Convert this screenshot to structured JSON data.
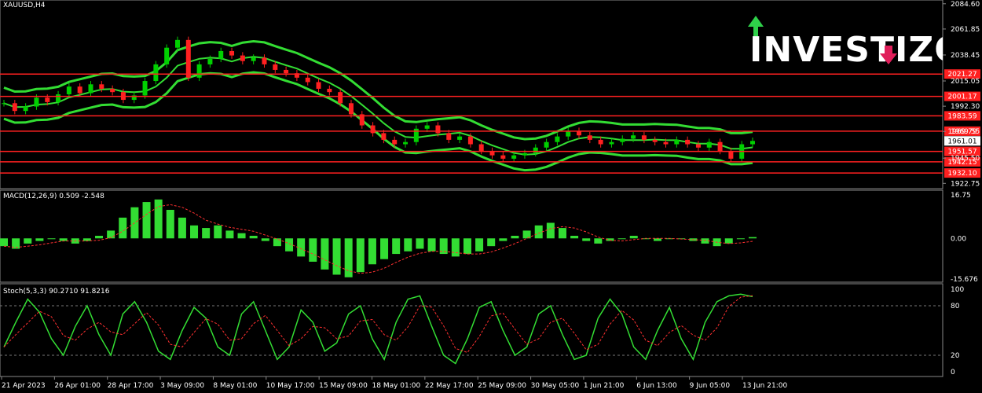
{
  "symbol": "XAUUSD,H4",
  "chart_data": [
    {
      "type": "line",
      "title": "XAUUSD,H4",
      "price_axis_ticks": [
        "2084.60",
        "2061.85",
        "2038.45",
        "2015.05",
        "1992.30",
        "1969.55",
        "1945.50",
        "1922.75"
      ],
      "price_axis_values": [
        2084.6,
        2061.85,
        2038.45,
        2015.05,
        1992.3,
        1969.55,
        1945.5,
        1922.75
      ],
      "ylim": [
        1918,
        2088
      ],
      "current_price": "1961.01",
      "horizontal_levels": [
        {
          "label": "2021.27",
          "value": 2021.27
        },
        {
          "label": "2001.17",
          "value": 2001.17
        },
        {
          "label": "1983.59",
          "value": 1983.59
        },
        {
          "label": "1969.79",
          "value": 1969.79
        },
        {
          "label": "1951.57",
          "value": 1951.57
        },
        {
          "label": "1942.15",
          "value": 1942.15
        },
        {
          "label": "1932.10",
          "value": 1932.1
        }
      ],
      "time_labels": [
        "21 Apr 2023",
        "26 Apr 01:00",
        "28 Apr 17:00",
        "3 May 09:00",
        "8 May 01:00",
        "10 May 17:00",
        "15 May 09:00",
        "18 May 01:00",
        "22 May 17:00",
        "25 May 09:00",
        "30 May 05:00",
        "1 Jun 21:00",
        "6 Jun 13:00",
        "9 Jun 05:00",
        "13 Jun 21:00"
      ],
      "price_path": [
        1995,
        1988,
        1992,
        2000,
        1996,
        2003,
        2010,
        2004,
        2012,
        2008,
        2005,
        1998,
        2002,
        2015,
        2030,
        2045,
        2052,
        2018,
        2030,
        2035,
        2042,
        2038,
        2033,
        2036,
        2030,
        2025,
        2022,
        2018,
        2014,
        2008,
        2005,
        1995,
        1985,
        1975,
        1968,
        1962,
        1958,
        1960,
        1972,
        1975,
        1968,
        1962,
        1965,
        1958,
        1952,
        1948,
        1945,
        1948,
        1950,
        1955,
        1960,
        1965,
        1970,
        1966,
        1962,
        1958,
        1960,
        1963,
        1966,
        1962,
        1960,
        1958,
        1962,
        1958,
        1955,
        1960,
        1952,
        1945,
        1958,
        1961
      ],
      "series": [
        {
          "name": "MACD(12,26,9) 0.509 -2.548",
          "values": [
            -3,
            -4,
            -2,
            -1,
            0,
            -1,
            -2,
            -1,
            1,
            3,
            8,
            12,
            14,
            15,
            11,
            8,
            5,
            4,
            5,
            3,
            2,
            1,
            -1,
            -3,
            -5,
            -7,
            -9,
            -12,
            -14,
            -15,
            -13,
            -10,
            -8,
            -6,
            -5,
            -4,
            -5,
            -6,
            -7,
            -6,
            -5,
            -3,
            -1,
            1,
            3,
            5,
            6,
            4,
            1,
            -1,
            -2,
            -1,
            0,
            1,
            0,
            -1,
            0,
            0,
            -1,
            -2,
            -3,
            -2,
            0,
            0.5
          ],
          "ylim": [
            -15.676,
            16.75
          ],
          "ticks": [
            "16.75",
            "0.00",
            "-15.676"
          ]
        },
        {
          "name": "Stoch(5,3,3) 90.2710 91.8216",
          "values": [
            30,
            60,
            88,
            72,
            40,
            20,
            55,
            80,
            45,
            20,
            70,
            85,
            60,
            25,
            15,
            50,
            78,
            65,
            30,
            20,
            70,
            85,
            50,
            15,
            30,
            75,
            60,
            25,
            35,
            70,
            80,
            40,
            15,
            60,
            88,
            92,
            55,
            20,
            10,
            40,
            78,
            85,
            50,
            20,
            30,
            70,
            80,
            45,
            15,
            20,
            65,
            88,
            70,
            30,
            15,
            50,
            78,
            40,
            15,
            60,
            85,
            92,
            94,
            91
          ],
          "ylim": [
            0,
            100
          ],
          "ticks": [
            "100",
            "80",
            "20",
            "0"
          ]
        }
      ]
    }
  ],
  "colors": {
    "background": "#000000",
    "candle_up": "#00d000",
    "candle_down": "#ff2020",
    "bands": "#33dd33",
    "level": "#ff2020",
    "macd": "#33dd33",
    "signal": "#ff3030",
    "stoch": "#33dd33",
    "grid": "#777777"
  },
  "logo": {
    "text": "INVESTIZO"
  }
}
